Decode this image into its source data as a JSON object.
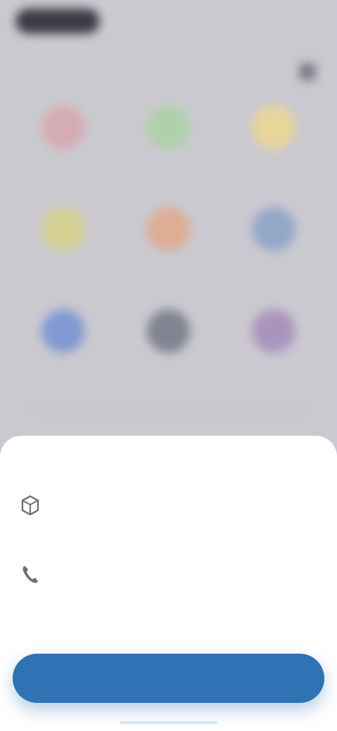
{
  "status": {
    "time": "",
    "signal": "",
    "battery": ""
  },
  "header": {
    "title": "",
    "action_icon": "more-icon"
  },
  "grid": [
    {
      "label": "",
      "color": "#d9a6ad"
    },
    {
      "label": "",
      "color": "#a9d2a2"
    },
    {
      "label": "",
      "color": "#ecd88d"
    },
    {
      "label": "",
      "color": "#d7d487"
    },
    {
      "label": "",
      "color": "#e0a88a"
    },
    {
      "label": "",
      "color": "#8aa1c7"
    },
    {
      "label": "",
      "color": "#7592d1"
    },
    {
      "label": "",
      "color": "#737886"
    },
    {
      "label": "",
      "color": "#a48bbb"
    }
  ],
  "sheet": {
    "title": "",
    "permissions": [
      {
        "name": "",
        "description": "",
        "icon": "app-icon"
      },
      {
        "name": "",
        "description": "",
        "icon": "phone-icon"
      }
    ],
    "button_label": ""
  }
}
